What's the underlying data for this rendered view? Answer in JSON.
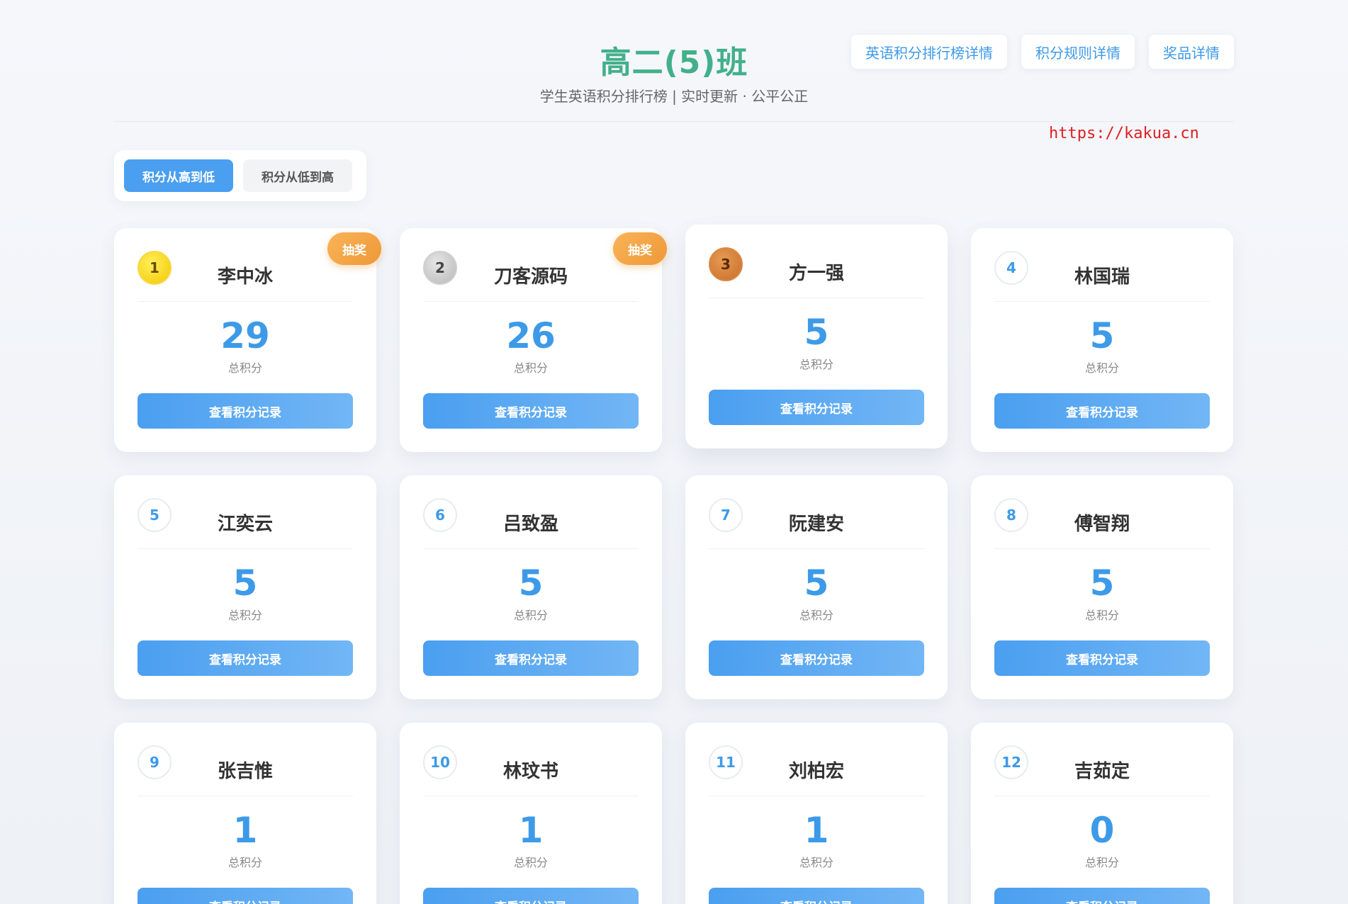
{
  "header": {
    "title": "高二(5)班",
    "subtitle": "学生英语积分排行榜 | 实时更新 · 公平公正",
    "links": [
      "英语积分排行榜详情",
      "积分规则详情",
      "奖品详情"
    ]
  },
  "watermark": "https://kakua.cn",
  "sort": {
    "desc_label": "积分从高到低",
    "asc_label": "积分从低到高"
  },
  "colors": {
    "title": "#43b08a",
    "accent": "#3d9ae8",
    "badge": "#f0a040"
  },
  "score_label": "总积分",
  "view_label": "查看积分记录",
  "lottery_label": "抽奖",
  "students": [
    {
      "rank": "1",
      "name": "李中冰",
      "score": "29",
      "medal": "gold",
      "lottery": true
    },
    {
      "rank": "2",
      "name": "刀客源码",
      "score": "26",
      "medal": "silver",
      "lottery": true
    },
    {
      "rank": "3",
      "name": "方一强",
      "score": "5",
      "medal": "bronze",
      "lottery": false
    },
    {
      "rank": "4",
      "name": "林国瑞",
      "score": "5",
      "medal": "",
      "lottery": false
    },
    {
      "rank": "5",
      "name": "江奕云",
      "score": "5",
      "medal": "",
      "lottery": false
    },
    {
      "rank": "6",
      "name": "吕致盈",
      "score": "5",
      "medal": "",
      "lottery": false
    },
    {
      "rank": "7",
      "name": "阮建安",
      "score": "5",
      "medal": "",
      "lottery": false
    },
    {
      "rank": "8",
      "name": "傅智翔",
      "score": "5",
      "medal": "",
      "lottery": false
    },
    {
      "rank": "9",
      "name": "张吉惟",
      "score": "1",
      "medal": "",
      "lottery": false
    },
    {
      "rank": "10",
      "name": "林玟书",
      "score": "1",
      "medal": "",
      "lottery": false
    },
    {
      "rank": "11",
      "name": "刘柏宏",
      "score": "1",
      "medal": "",
      "lottery": false
    },
    {
      "rank": "12",
      "name": "吉茹定",
      "score": "0",
      "medal": "",
      "lottery": false
    }
  ]
}
